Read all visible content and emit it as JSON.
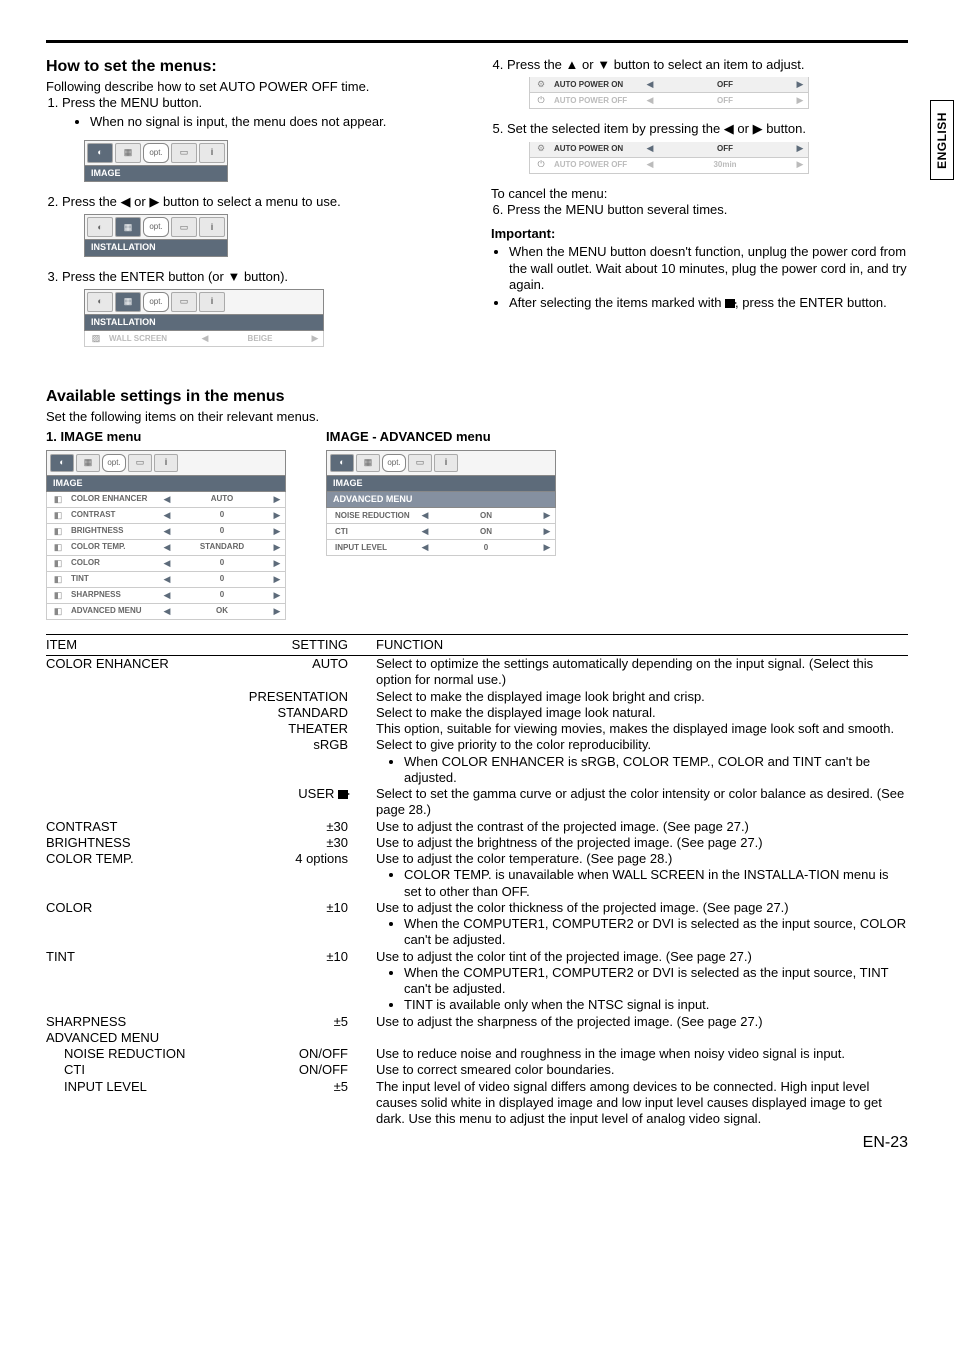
{
  "sideTab": "ENGLISH",
  "howTo": {
    "title": "How to set the menus:",
    "intro": "Following describe how to set AUTO POWER OFF time.",
    "step1": "Press the MENU button.",
    "step1_bullet": "When no signal is input, the menu does not appear.",
    "step2_a": "Press the ",
    "step2_b": " or ",
    "step2_c": " button to select a menu to use.",
    "step3_a": "Press the ENTER button (or ",
    "step3_b": " button).",
    "step4_a": "Press the ",
    "step4_b": " or ",
    "step4_c": " button to select an item to adjust.",
    "step5_a": "Set the selected item by pressing the ",
    "step5_b": " or ",
    "step5_c": " button.",
    "cancel_title": "To cancel the menu:",
    "step6": "Press the MENU button several times.",
    "important_label": "Important:",
    "important_b1": "When the MENU button doesn't function, unplug the power cord from the wall outlet. Wait about 10 minutes, plug the power cord in, and try again.",
    "important_b2_a": "After selecting the items marked with ",
    "important_b2_b": ", press the ENTER button."
  },
  "menuFig1": {
    "title": "IMAGE"
  },
  "menuFig2": {
    "title": "INSTALLATION"
  },
  "menuFig3": {
    "title": "INSTALLATION",
    "row_label": "WALL SCREEN",
    "row_val": "BEIGE"
  },
  "menuFig4": {
    "row1_label": "AUTO POWER ON",
    "row1_val": "OFF",
    "row2_label": "AUTO POWER OFF",
    "row2_val": "OFF"
  },
  "menuFig5": {
    "row1_label": "AUTO POWER ON",
    "row1_val": "OFF",
    "row2_label": "AUTO POWER OFF",
    "row2_val": "30min"
  },
  "avail": {
    "title": "Available settings in the menus",
    "intro": "Set the following items on their relevant menus.",
    "imageMenu_label": "1. IMAGE menu",
    "advMenu_label": "IMAGE - ADVANCED menu",
    "imageMenu": {
      "title": "IMAGE",
      "rows": [
        {
          "label": "COLOR ENHANCER",
          "val": "AUTO"
        },
        {
          "label": "CONTRAST",
          "val": "0"
        },
        {
          "label": "BRIGHTNESS",
          "val": "0"
        },
        {
          "label": "COLOR TEMP.",
          "val": "STANDARD"
        },
        {
          "label": "COLOR",
          "val": "0"
        },
        {
          "label": "TINT",
          "val": "0"
        },
        {
          "label": "SHARPNESS",
          "val": "0"
        },
        {
          "label": "ADVANCED MENU",
          "val": "OK"
        }
      ]
    },
    "advMenu": {
      "title": "IMAGE",
      "sub": "ADVANCED MENU",
      "rows": [
        {
          "label": "NOISE REDUCTION",
          "val": "ON"
        },
        {
          "label": "CTI",
          "val": "ON"
        },
        {
          "label": "INPUT LEVEL",
          "val": "0"
        }
      ]
    }
  },
  "tbl": {
    "h_item": "ITEM",
    "h_set": "SETTING",
    "h_func": "FUNCTION",
    "rows": [
      {
        "item": "COLOR ENHANCER",
        "set": "AUTO",
        "func": "Select to optimize the settings automatically depending on the input signal. (Select this option for normal use.)"
      },
      {
        "item": "",
        "set": "PRESENTATION",
        "func": "Select to make the displayed image look bright and crisp."
      },
      {
        "item": "",
        "set": "STANDARD",
        "func": "Select to make the displayed image look natural."
      },
      {
        "item": "",
        "set": "THEATER",
        "func": "This option, suitable for viewing movies, makes the displayed image look soft and smooth."
      },
      {
        "item": "",
        "set": "sRGB",
        "func": "Select to give priority to the color reproducibility."
      },
      {
        "item": "",
        "set": "",
        "func": "When COLOR ENHANCER is sRGB, COLOR TEMP., COLOR and TINT can't be adjusted.",
        "bullet": true
      },
      {
        "item": "",
        "set": "USER",
        "enter": true,
        "func": "Select to set the gamma curve or adjust the color intensity or color balance as desired. (See page 28.)"
      },
      {
        "item": "CONTRAST",
        "set": "±30",
        "func": "Use to adjust the contrast of the projected image. (See page 27.)"
      },
      {
        "item": "BRIGHTNESS",
        "set": "±30",
        "func": "Use to adjust the brightness of the projected image. (See page 27.)"
      },
      {
        "item": "COLOR TEMP.",
        "set": "4 options",
        "func": "Use to adjust the color temperature. (See page 28.)"
      },
      {
        "item": "",
        "set": "",
        "func": "COLOR TEMP. is unavailable when WALL SCREEN in the INSTALLA-TION menu is set to other than OFF.",
        "bullet": true
      },
      {
        "item": "COLOR",
        "set": "±10",
        "func": "Use to adjust the color thickness of the projected image. (See page 27.)"
      },
      {
        "item": "",
        "set": "",
        "func": "When the COMPUTER1, COMPUTER2 or DVI is selected as the input source, COLOR can't be adjusted.",
        "bullet": true
      },
      {
        "item": "TINT",
        "set": "±10",
        "func": "Use to adjust the color tint of the projected image. (See page 27.)"
      },
      {
        "item": "",
        "set": "",
        "func": "When the COMPUTER1, COMPUTER2 or DVI is selected as the input source, TINT can't be adjusted.",
        "bullet": true
      },
      {
        "item": "",
        "set": "",
        "func": "TINT is available only when the NTSC signal is input.",
        "bullet": true
      },
      {
        "item": "SHARPNESS",
        "set": "±5",
        "func": "Use to adjust the sharpness of the projected image. (See page 27.)"
      },
      {
        "item": "ADVANCED MENU",
        "set": "",
        "func": ""
      },
      {
        "item": "NOISE REDUCTION",
        "indent": true,
        "set": "ON/OFF",
        "func": "Use to reduce noise and roughness in the image when noisy video signal is input."
      },
      {
        "item": "CTI",
        "indent": true,
        "set": "ON/OFF",
        "func": "Use to correct smeared color boundaries."
      },
      {
        "item": "INPUT LEVEL",
        "indent": true,
        "set": "±5",
        "func": "The input level of video signal differs among devices to be connected. High input level causes solid white in displayed image and low input level causes displayed image to get dark. Use this menu to adjust the input level of analog video signal."
      }
    ]
  },
  "pageNo": "EN-23"
}
